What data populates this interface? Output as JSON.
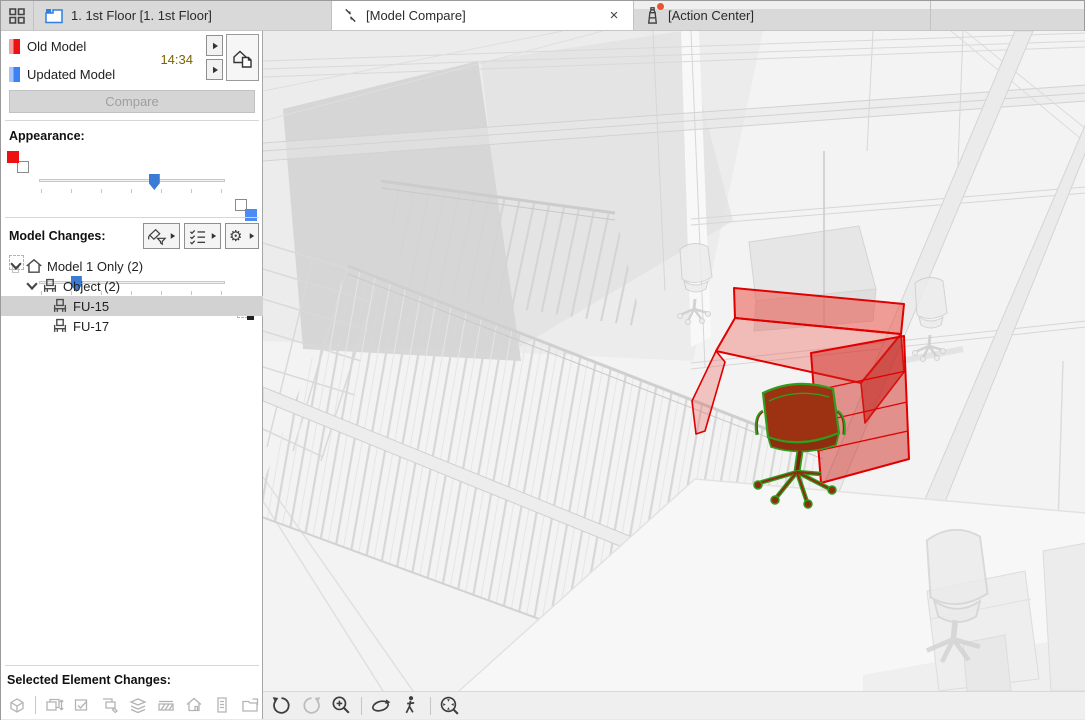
{
  "tab_bar": {
    "tabs": [
      {
        "id": "first-floor",
        "label": "1. 1st Floor [1. 1st Floor]"
      },
      {
        "id": "model-compare",
        "label": "[Model Compare]",
        "close_glyph": "×"
      },
      {
        "id": "action-center",
        "label": "[Action Center]"
      }
    ]
  },
  "compare_panel": {
    "old_model_label": "Old Model",
    "updated_model_label": "Updated Model",
    "time": "14:34",
    "compare_button_label": "Compare",
    "appearance_label": "Appearance:",
    "appearance": {
      "highlight_slider_percent": 62,
      "ghost_slider_percent": 21
    },
    "model_changes_label": "Model Changes:",
    "tree_rows": [
      {
        "label": "Model 1 Only (2)",
        "level": 0,
        "expanded": true
      },
      {
        "label": "Object (2)",
        "level": 1,
        "expanded": true
      },
      {
        "label": "FU-15",
        "level": 2,
        "selected": true
      },
      {
        "label": "FU-17",
        "level": 2,
        "selected": false
      }
    ],
    "selected_element_changes_label": "Selected Element Changes:"
  },
  "toolbars": {
    "model_changes_buttons": [
      "highlight-filter",
      "change-criteria-list",
      "settings"
    ],
    "selected_element_icons": [
      "3d-cube",
      "position-change",
      "parameter-change",
      "surface-change",
      "layer-change",
      "fill-change",
      "model-change",
      "info-list",
      "library-part"
    ],
    "viewport_icons": [
      "previous-view",
      "next-view",
      "increase-zoom",
      "orbit",
      "explore",
      "fit-in-window"
    ]
  },
  "colors": {
    "old_model": "#ee1111",
    "updated_model": "#3b82f6",
    "highlight_red": "#e00000",
    "change_green": "#2f9e1e",
    "tree_selection_bg": "#d2d2d2",
    "time_text": "#7a6400"
  }
}
